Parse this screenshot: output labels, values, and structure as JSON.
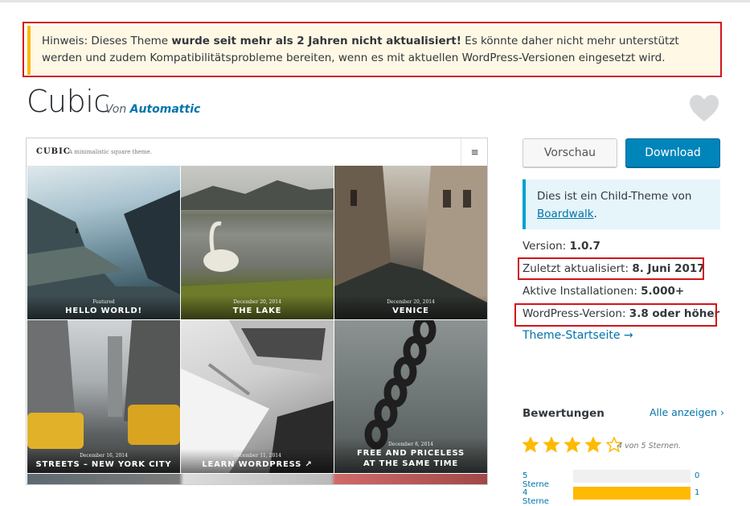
{
  "notice": {
    "prefix": "Hinweis: Dieses Theme ",
    "bold": "wurde seit mehr als 2 Jahren nicht aktualisiert!",
    "suffix": " Es könnte daher nicht mehr unterstützt werden und zudem Kompatibilitätsprobleme bereiten, wenn es mit aktuellen WordPress-Versionen eingesetzt wird."
  },
  "theme": {
    "title": "Cubic",
    "by": "Von",
    "author": "Automattic",
    "favorite_icon": "heart-icon"
  },
  "screenshot": {
    "logo": "CUBIC",
    "tagline": "A minimalistic square theme.",
    "menu_icon": "≡",
    "tiles": [
      {
        "date": "Featured",
        "title": "HELLO WORLD!"
      },
      {
        "date": "December 20, 2014",
        "title": "THE LAKE"
      },
      {
        "date": "December 20, 2014",
        "title": "VENICE"
      },
      {
        "date": "December 16, 2014",
        "title": "STREETS – NEW YORK CITY"
      },
      {
        "date": "December 11, 2014",
        "title": "LEARN WORDPRESS ↗"
      },
      {
        "date": "December 8, 2014",
        "title": "FREE AND PRICELESS AT THE SAME TIME"
      }
    ]
  },
  "actions": {
    "preview": "Vorschau",
    "download": "Download"
  },
  "child_theme": {
    "text": "Dies ist ein Child-Theme von",
    "parent": "Boardwalk",
    "end": "."
  },
  "meta": {
    "version_label": "Version: ",
    "version": "1.0.7",
    "updated_label": "Zuletzt aktualisiert: ",
    "updated": "8. Juni 2017",
    "installs_label": "Aktive Installationen: ",
    "installs": "5.000+",
    "wp_label": "WordPress-Version: ",
    "wp": "3.8 oder höher",
    "homepage": "Theme-Startseite →"
  },
  "ratings": {
    "title": "Bewertungen",
    "see_all": "Alle anzeigen ›",
    "stars": 4,
    "stars_max": 5,
    "summary": "4 von 5 Sternen.",
    "rows": [
      {
        "label": "5 Sterne",
        "count": "0",
        "fraction": 0
      },
      {
        "label": "4 Sterne",
        "count": "1",
        "fraction": 1
      }
    ]
  },
  "colors": {
    "accent": "#0073aa",
    "button": "#0085ba",
    "star": "#ffb900",
    "highlight": "#d0151a"
  }
}
